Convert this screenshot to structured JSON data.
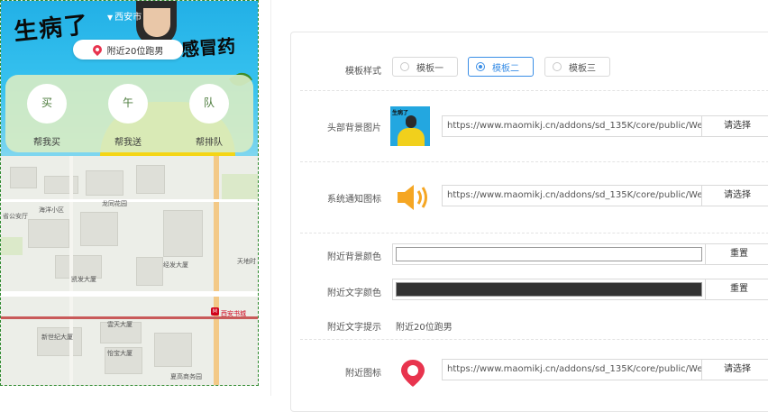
{
  "preview": {
    "city": "西安市",
    "banner_text_1": "生病了",
    "banner_text_2": "感冒药",
    "nearby_text": "附近20位跑男",
    "actions": [
      {
        "label": "帮我买",
        "glyph": "买"
      },
      {
        "label": "帮我送",
        "glyph": "午"
      },
      {
        "label": "帮排队",
        "glyph": "队"
      }
    ],
    "map_labels": {
      "haiyang": "海洋小区",
      "longtong": "龙同花园",
      "gongan": "省公安厅",
      "jingfa": "经发大厦",
      "kaifa": "凯发大厦",
      "tiandi": "天地时",
      "jinshiji": "新世纪大厦",
      "yuntian": "雲天大厦",
      "yifeng": "怡宝大厦",
      "bookstore": "西安书城",
      "jiayuan": "夏高商务园"
    }
  },
  "settings": {
    "template_style": {
      "label": "模板样式",
      "options": [
        "模板一",
        "模板二",
        "模板三"
      ],
      "selected": "模板二"
    },
    "header_bg": {
      "label": "头部背景图片",
      "url": "https://www.maomikj.cn/addons/sd_135K/core/public/WeCha",
      "button": "请选择",
      "thumb_text": "生病了"
    },
    "notice_icon": {
      "label": "系统通知图标",
      "url": "https://www.maomikj.cn/addons/sd_135K/core/public/WeCha",
      "button": "请选择",
      "icon_color": "#f5a623"
    },
    "nearby_bg_color": {
      "label": "附近背景颜色",
      "value": "#ffffff",
      "button": "重置"
    },
    "nearby_text_color": {
      "label": "附近文字颜色",
      "value": "#333333",
      "button": "重置"
    },
    "nearby_hint": {
      "label": "附近文字提示",
      "value": "附近20位跑男"
    },
    "nearby_icon": {
      "label": "附近图标",
      "url": "https://www.maomikj.cn/addons/sd_135K/core/public/WeCha",
      "button": "请选择",
      "icon_color": "#e8344e"
    }
  },
  "colors": {
    "accent": "#3a8ee6",
    "preview_border": "#2f8a2f",
    "banner_blue": "#22b0e6",
    "pin_red": "#e8344e"
  }
}
